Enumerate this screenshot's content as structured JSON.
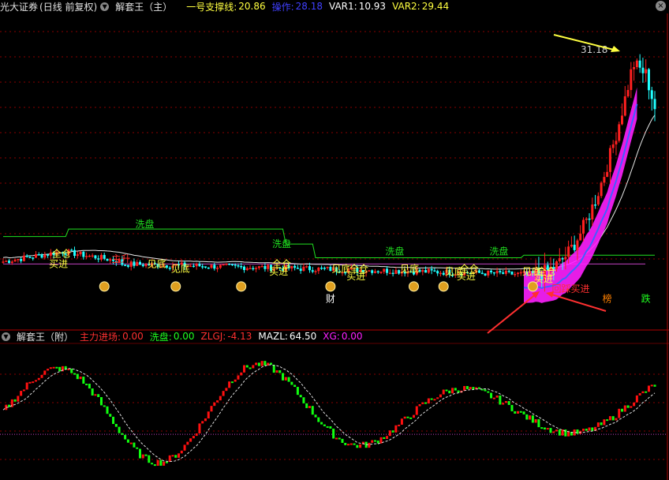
{
  "header": {
    "broker": "光大证券",
    "period": "(日线 前复权)",
    "indicator": "解套王（主）",
    "support_label": "一号支撑线:",
    "support_value": "20.86",
    "op_label": "操作:",
    "op_value": "28.18",
    "var1_label": "VAR1:",
    "var1_value": "10.93",
    "var2_label": "VAR2:",
    "var2_value": "29.44"
  },
  "sub_header": {
    "indicator": "解套王（附）",
    "main_flow_label": "主力进场:",
    "main_flow_value": "0.00",
    "wash_label": "洗盘:",
    "wash_value": "0.00",
    "zlgj_label": "ZLGJ:",
    "zlgj_value": "-4.13",
    "mazl_label": "MAZL:",
    "mazl_value": "64.50",
    "xg_label": "XG:",
    "xg_value": "0.00"
  },
  "colors": {
    "up": "#ff2020",
    "down": "#20ffff",
    "support": "#20e020",
    "ma_white": "#e8e8e8",
    "band": "#ff20ff",
    "signal_yellow": "#ffff40",
    "bar_red": "#ff1010",
    "bar_green": "#10ff10",
    "grid": "#8a0000"
  },
  "chart_data": [
    {
      "type": "candlestick",
      "panel": "main",
      "price_label": "31.18",
      "annotations": [
        {
          "text": "洗盘",
          "x": 46,
          "y": 24.2,
          "color": "#20e020"
        },
        {
          "text": "洗盘",
          "x": 92,
          "y": 23.4,
          "color": "#20e020"
        },
        {
          "text": "洗盘",
          "x": 130,
          "y": 23.1,
          "color": "#20e020"
        },
        {
          "text": "洗盘",
          "x": 165,
          "y": 23.1,
          "color": "#20e020"
        },
        {
          "text": "全仓",
          "x": 18,
          "y": 23.0,
          "color": "#ffff40"
        },
        {
          "text": "买进",
          "x": 17,
          "y": 22.6,
          "color": "#ffff40"
        },
        {
          "text": "主升",
          "x": 38,
          "y": 22.8,
          "color": "#ff3030"
        },
        {
          "text": "见底",
          "x": 50,
          "y": 22.6,
          "color": "#ffff40"
        },
        {
          "text": "见底",
          "x": 58,
          "y": 22.4,
          "color": "#ffff40"
        },
        {
          "text": "全仓",
          "x": 92,
          "y": 22.6,
          "color": "#ffff40"
        },
        {
          "text": "买进",
          "x": 91,
          "y": 22.3,
          "color": "#ffff40"
        },
        {
          "text": "见底",
          "x": 112,
          "y": 22.4,
          "color": "#ffff40"
        },
        {
          "text": "全仓",
          "x": 118,
          "y": 22.4,
          "color": "#ffff40"
        },
        {
          "text": "买进",
          "x": 117,
          "y": 22.1,
          "color": "#ffff40"
        },
        {
          "text": "见底",
          "x": 135,
          "y": 22.4,
          "color": "#ffff40"
        },
        {
          "text": "见底",
          "x": 150,
          "y": 22.3,
          "color": "#ffff40"
        },
        {
          "text": "全仓",
          "x": 155,
          "y": 22.4,
          "color": "#ffff40"
        },
        {
          "text": "买进",
          "x": 154,
          "y": 22.1,
          "color": "#ffff40"
        },
        {
          "text": "见底",
          "x": 176,
          "y": 22.3,
          "color": "#ffff40"
        },
        {
          "text": "全仓",
          "x": 181,
          "y": 22.3,
          "color": "#ffff40"
        },
        {
          "text": "买进",
          "x": 180,
          "y": 22.0,
          "color": "#ffff40"
        },
        {
          "text": "回踩买进",
          "x": 186,
          "y": 21.6,
          "color": "#ff3030"
        },
        {
          "text": "财",
          "x": 110,
          "y": 21.2,
          "color": "#ffffff"
        },
        {
          "text": "榜",
          "x": 203,
          "y": 21.2,
          "color": "#ff8000"
        },
        {
          "text": "跌",
          "x": 216,
          "y": 21.2,
          "color": "#20ff20"
        }
      ],
      "money_icons_x": [
        34,
        58,
        80,
        110,
        138,
        148,
        178
      ],
      "ylim": [
        21,
        32
      ]
    },
    {
      "type": "bar",
      "panel": "sub",
      "ylim": [
        0,
        100
      ]
    }
  ]
}
